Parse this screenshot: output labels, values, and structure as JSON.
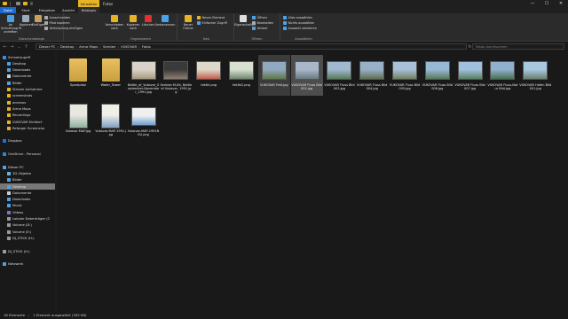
{
  "window": {
    "context_tab": "Verwalten",
    "title": "Fotos",
    "min": "—",
    "max": "☐",
    "close": "✕"
  },
  "ribbon_tabs": [
    "Datei",
    "Start",
    "Freigeben",
    "Ansicht",
    "Bildtools"
  ],
  "ribbon": {
    "pin_label": "An Schnellzugriff anheften",
    "copy_label": "Kopieren",
    "paste_label": "Einfügen",
    "cut_label": "Ausschneiden",
    "copy_path_label": "Pfad kopieren",
    "paste_shortcut_label": "Verknüpfung einfügen",
    "group_clipboard": "Zwischenablage",
    "move_to_label": "Verschieben nach",
    "copy_to_label": "Kopieren nach",
    "delete_label": "Löschen",
    "rename_label": "Umbenennen",
    "group_organize": "Organisieren",
    "new_folder_label": "Neuer Ordner",
    "new_item_label": "Neues Element",
    "easy_access_label": "Einfacher Zugriff",
    "group_new": "Neu",
    "properties_label": "Eigenschaften",
    "open_label": "Öffnen",
    "edit_label": "Bearbeiten",
    "history_label": "Verlauf",
    "group_open": "Öffnen",
    "select_all_label": "Alles auswählen",
    "select_none_label": "Nichts auswählen",
    "invert_selection_label": "Auswahl umkehren",
    "group_select": "Auswählen"
  },
  "address": {
    "back": "←",
    "forward": "→",
    "recent": "⌄",
    "up": "↑",
    "breadcrumbs": [
      "Dieser PC",
      "Desktop",
      "Arma Maps",
      "Serbien",
      "VUKOVAR",
      "Fotos"
    ],
    "refresh": "↻",
    "search_placeholder": "Fotos durchsuchen"
  },
  "nav": [
    {
      "label": "Schnellzugriff",
      "color": "#3b8de0",
      "indent": 1,
      "selected": false
    },
    {
      "label": "Desktop",
      "color": "#4aa3e8",
      "indent": 2,
      "selected": false
    },
    {
      "label": "Downloads",
      "color": "#4aa3e8",
      "indent": 2,
      "selected": false
    },
    {
      "label": "Dokumente",
      "color": "#cccccc",
      "indent": 2,
      "selected": false
    },
    {
      "label": "Bilder",
      "color": "#5aa0d8",
      "indent": 2,
      "selected": false
    },
    {
      "label": "Stream Aufnahme",
      "color": "#e5b325",
      "indent": 2,
      "selected": false
    },
    {
      "label": "screenshots",
      "color": "#e5b325",
      "indent": 2,
      "selected": false
    },
    {
      "label": "oceanos",
      "color": "#e5b325",
      "indent": 2,
      "selected": false
    },
    {
      "label": "Arma Maps",
      "color": "#e5b325",
      "indent": 2,
      "selected": false
    },
    {
      "label": "Recordings",
      "color": "#e5b325",
      "indent": 2,
      "selected": false
    },
    {
      "label": "VUKOVAR Einfahrt",
      "color": "#e5b325",
      "indent": 2,
      "selected": false
    },
    {
      "label": "Reforger Screensho",
      "color": "#e5b325",
      "indent": 2,
      "selected": false
    },
    {
      "label": "",
      "color": "",
      "indent": 0,
      "selected": false
    },
    {
      "label": "Dropbox",
      "color": "#1f6fe0",
      "indent": 1,
      "selected": false
    },
    {
      "label": "",
      "color": "",
      "indent": 0,
      "selected": false
    },
    {
      "label": "OneDrive - Personal",
      "color": "#2b88d8",
      "indent": 1,
      "selected": false
    },
    {
      "label": "",
      "color": "",
      "indent": 0,
      "selected": false
    },
    {
      "label": "Dieser PC",
      "color": "#5aa0d8",
      "indent": 1,
      "selected": false
    },
    {
      "label": "3D-Objekte",
      "color": "#6ab0e0",
      "indent": 2,
      "selected": false
    },
    {
      "label": "Bilder",
      "color": "#5aa0d8",
      "indent": 2,
      "selected": false
    },
    {
      "label": "Desktop",
      "color": "#4aa3e8",
      "indent": 2,
      "selected": true
    },
    {
      "label": "Dokumente",
      "color": "#cccccc",
      "indent": 2,
      "selected": false
    },
    {
      "label": "Downloads",
      "color": "#4aa3e8",
      "indent": 2,
      "selected": false
    },
    {
      "label": "Musik",
      "color": "#4aa3e8",
      "indent": 2,
      "selected": false
    },
    {
      "label": "Videos",
      "color": "#8a6ad8",
      "indent": 2,
      "selected": false
    },
    {
      "label": "Lokaler Datenträger (C",
      "color": "#999999",
      "indent": 2,
      "selected": false
    },
    {
      "label": "Volume (D:)",
      "color": "#999999",
      "indent": 2,
      "selected": false
    },
    {
      "label": "Volume (E:)",
      "color": "#999999",
      "indent": 2,
      "selected": false
    },
    {
      "label": "DJ_STICK (H:)",
      "color": "#999999",
      "indent": 2,
      "selected": false
    },
    {
      "label": "",
      "color": "",
      "indent": 0,
      "selected": false
    },
    {
      "label": "DJ_STICK (H:)",
      "color": "#999999",
      "indent": 1,
      "selected": false
    },
    {
      "label": "",
      "color": "",
      "indent": 0,
      "selected": false
    },
    {
      "label": "Netzwerk",
      "color": "#5aa0d8",
      "indent": 1,
      "selected": false
    }
  ],
  "files": [
    {
      "name": "Sportplatz",
      "kind": "folder",
      "colors": [
        "#e8c060",
        "#c8a040"
      ],
      "state": ""
    },
    {
      "name": "Water_Tower",
      "kind": "folder",
      "colors": [
        "#e8c060",
        "#c8a040"
      ],
      "state": ""
    },
    {
      "name": "Battle_of_Vukovar_September-November_1991.jpg",
      "kind": "land",
      "colors": [
        "#d8d4c8",
        "#a89a80"
      ],
      "state": ""
    },
    {
      "name": "Serbian M-84, Battle of Vukovar, 1991.jpg",
      "kind": "land",
      "colors": [
        "#3a3a3a",
        "#8a8070"
      ],
      "state": ""
    },
    {
      "name": "tektik.png",
      "kind": "land",
      "colors": [
        "#e0d8c8",
        "#c06050"
      ],
      "state": ""
    },
    {
      "name": "tektik2.png",
      "kind": "land",
      "colors": [
        "#d8e0d0",
        "#708870"
      ],
      "state": ""
    },
    {
      "name": "VUKOVAR Feld.jpg",
      "kind": "land",
      "colors": [
        "#90a8c0",
        "#607848"
      ],
      "state": "hover"
    },
    {
      "name": "VUKOVAR Fluss Bild 002.jpg",
      "kind": "land",
      "colors": [
        "#a8b8c8",
        "#6a7a80"
      ],
      "state": "selected"
    },
    {
      "name": "VUKOVAR Fluss Bild 003.jpg",
      "kind": "land",
      "colors": [
        "#a0b8d0",
        "#5a7a58"
      ],
      "state": ""
    },
    {
      "name": "VUKOVAR Fluss Bild 004.jpg",
      "kind": "land",
      "colors": [
        "#98b0c8",
        "#607050"
      ],
      "state": ""
    },
    {
      "name": "VUKOVAR Fluss Bild 005.jpg",
      "kind": "land",
      "colors": [
        "#a8c0d8",
        "#708060"
      ],
      "state": ""
    },
    {
      "name": "VUKOVAR Fluss Bild 006.jpg",
      "kind": "land",
      "colors": [
        "#98b8d8",
        "#587858"
      ],
      "state": ""
    },
    {
      "name": "VUKOVAR Fluss Bild 007.jpg",
      "kind": "land",
      "colors": [
        "#a0c0e0",
        "#5a8060"
      ],
      "state": ""
    },
    {
      "name": "VUKOVAR Fluss-Natur Bild.jpg",
      "kind": "land",
      "colors": [
        "#90b0d0",
        "#4a7050"
      ],
      "state": ""
    },
    {
      "name": "VUKOVAR Hafen Bild 001.jpg",
      "kind": "land",
      "colors": [
        "#a8c8e0",
        "#6a8070"
      ],
      "state": ""
    },
    {
      "name": "Vukovar-MAP.jpg",
      "kind": "port",
      "colors": [
        "#e8e8e0",
        "#90b0a0"
      ],
      "state": ""
    },
    {
      "name": "Vukovar-MAP-1991.jpg",
      "kind": "port",
      "colors": [
        "#f0f0e8",
        "#80a0c0"
      ],
      "state": ""
    },
    {
      "name": "Vukovar-MAP-1991NEU.png",
      "kind": "land",
      "colors": [
        "#f0f0f0",
        "#70a0d0"
      ],
      "state": ""
    }
  ],
  "status": {
    "count": "18 Elemente",
    "selection": "1 Element ausgewählt (355 KB)"
  }
}
